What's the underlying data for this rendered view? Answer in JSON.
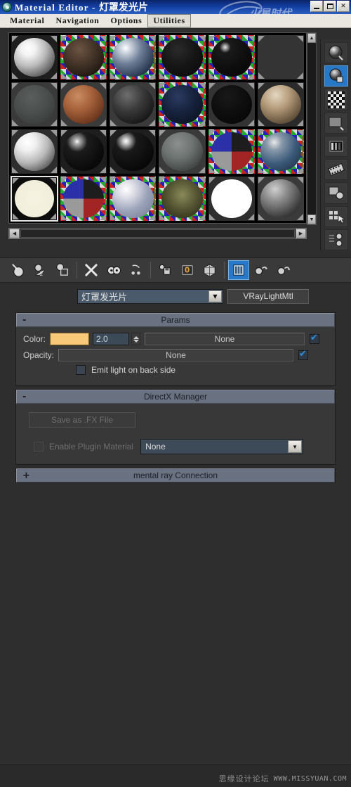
{
  "window": {
    "title_en": "Material Editor",
    "title_sep": " - ",
    "title_cn": "灯罩发光片",
    "icon": "material-editor-icon",
    "buttons": {
      "minimize": "minimize-button",
      "maximize": "maximize-button",
      "close": "✕"
    }
  },
  "menubar": {
    "items": [
      {
        "label": "Material",
        "active": false
      },
      {
        "label": "Navigation",
        "active": false
      },
      {
        "label": "Options",
        "active": false
      },
      {
        "label": "Utilities",
        "active": true
      }
    ]
  },
  "slots": {
    "rows": 4,
    "cols": 6,
    "selected_index": 18,
    "items": [
      {
        "name": "slot-1",
        "style": "shiny-white",
        "checker": false,
        "sphere": "radial-gradient(circle at 35% 28%, #ffffff 0%, #f2f2f2 18%, #bcbcbc 45%, #5a5a5a 78%, #2a2a2a 100%)",
        "bg": "#1e1e1e"
      },
      {
        "name": "slot-2",
        "style": "dark-wood",
        "checker": true,
        "sphere": "radial-gradient(circle at 40% 30%, #6d5442 0%, #4a392c 35%, #241a13 75%, #120d09 100%)",
        "bg": "#1a1a1a"
      },
      {
        "name": "slot-3",
        "style": "glass-checker",
        "checker": true,
        "sphere": "radial-gradient(circle at 32% 26%, #ffffff 0%, #cfd6e0 12%, #6c7d95 40%, #22304a 80%, #0d1421 100%)",
        "bg": "#141414"
      },
      {
        "name": "slot-4",
        "style": "black-rough",
        "checker": true,
        "sphere": "radial-gradient(circle at 40% 30%, #2a2a2a 0%, #161616 45%, #080808 100%)",
        "bg": "#111111"
      },
      {
        "name": "slot-5",
        "style": "black-gloss",
        "checker": true,
        "sphere": "radial-gradient(circle at 34% 24%, #e8e8e8 0%, #1a1a1a 14%, #0c0c0c 60%, #050505 100%)",
        "bg": "#111111"
      },
      {
        "name": "slot-6",
        "style": "empty-gray",
        "checker": false,
        "sphere": "none",
        "bg": "#343434"
      },
      {
        "name": "slot-7",
        "style": "gray-flat",
        "checker": false,
        "sphere": "radial-gradient(circle at 42% 32%, #5a5e5c 0%, #4a4e4c 45%, #303432 100%)",
        "bg": "#3a3a3a"
      },
      {
        "name": "slot-8",
        "style": "copper",
        "checker": false,
        "sphere": "radial-gradient(circle at 36% 28%, #c98d63 0%, #a9643c 35%, #6d381f 75%, #3a1c0f 100%)",
        "bg": "#3a3a3a"
      },
      {
        "name": "slot-9",
        "style": "dark-gloss",
        "checker": false,
        "sphere": "radial-gradient(circle at 36% 26%, #6e6e6e 0%, #3a3a3a 40%, #151515 80%, #0a0a0a 100%)",
        "bg": "#3a3a3a"
      },
      {
        "name": "slot-10",
        "style": "blue-dark",
        "checker": true,
        "sphere": "radial-gradient(circle at 40% 30%, #2b3a60 0%, #16223c 45%, #080c18 100%)",
        "bg": "#1a1a1a"
      },
      {
        "name": "slot-11",
        "style": "near-black",
        "checker": false,
        "sphere": "radial-gradient(circle at 40% 30%, #191919 0%, #0d0d0d 50%, #040404 100%)",
        "bg": "#333333"
      },
      {
        "name": "slot-12",
        "style": "marble-tex",
        "checker": false,
        "sphere": "radial-gradient(circle at 38% 26%, #e2d7c2 0%, #b79d7c 35%, #6d5a43 70%, #2e2519 100%)",
        "bg": "#2a2a2a"
      },
      {
        "name": "slot-13",
        "style": "white-shiny",
        "checker": false,
        "sphere": "radial-gradient(circle at 33% 26%, #ffffff 0%, #efefef 22%, #b8b8b8 52%, #4e4e4e 85%, #222222 100%)",
        "bg": "#2e2e2e"
      },
      {
        "name": "slot-14",
        "style": "black-hl",
        "checker": false,
        "sphere": "radial-gradient(circle at 34% 24%, #ffffff 0%, #b4b4b4 6%, #1c1c1c 26%, #0a0a0a 70%, #050505 100%)",
        "bg": "#1e1e1e"
      },
      {
        "name": "slot-15",
        "style": "black-hl2",
        "checker": false,
        "sphere": "radial-gradient(circle at 33% 23%, #ffffff 0%, #c8c8c8 7%, #1a1a1a 25%, #090909 72%, #040404 100%)",
        "bg": "#1e1e1e"
      },
      {
        "name": "slot-16",
        "style": "gray-satin",
        "checker": false,
        "sphere": "radial-gradient(circle at 40% 30%, #8b8f8d 0%, #6d7371 40%, #3d4240 80%, #202523 100%)",
        "bg": "#3a3a3a"
      },
      {
        "name": "slot-17",
        "style": "multi-quad",
        "checker": true,
        "sphere": "conic-gradient(from 180deg, #9a9a9a 0deg 90deg, #2b2fa8 90deg 180deg, #1d1d1d 180deg 270deg, #a32424 270deg 360deg)",
        "bg": "#141414"
      },
      {
        "name": "slot-18",
        "style": "noisy-checker",
        "checker": true,
        "sphere": "radial-gradient(circle at 34% 26%, #e8e8e8 0%, #8899aa 20%, #3b5a7a 55%, #18263a 100%)",
        "bg": "#141414"
      },
      {
        "name": "slot-19",
        "style": "cream-emissive",
        "checker": false,
        "sphere": "radial-gradient(circle at 50% 50%, #f6f3e2 0%, #f2eedb 70%, #e9e4cd 100%)",
        "bg": "#0d0d0d"
      },
      {
        "name": "slot-20",
        "style": "multi-quad2",
        "checker": true,
        "sphere": "conic-gradient(from 180deg, #9a9a9a 0deg 90deg, #2b2fa8 90deg 180deg, #1d1d1d 180deg 270deg, #a32424 270deg 360deg)",
        "bg": "#141414"
      },
      {
        "name": "slot-21",
        "style": "frost-checker",
        "checker": true,
        "sphere": "radial-gradient(circle at 33% 26%, #ffffff 0%, #dcdce6 22%, #9aa2b8 55%, #6f7892 100%)",
        "bg": "#141414"
      },
      {
        "name": "slot-22",
        "style": "olive-cloth",
        "checker": true,
        "sphere": "radial-gradient(circle at 50% 40%, #8a8a5a 0%, #5c5c38 40%, #30301c 85%, #16160c 100%)",
        "bg": "#141414"
      },
      {
        "name": "slot-23",
        "style": "pure-white",
        "checker": false,
        "sphere": "radial-gradient(circle at 50% 50%, #ffffff 0%, #ffffff 76%, #f2f2f2 100%)",
        "bg": "#2e2e2e"
      },
      {
        "name": "slot-24",
        "style": "gray-shaded",
        "checker": false,
        "sphere": "radial-gradient(circle at 36% 26%, #cfcfcf 0%, #8e8e8e 30%, #3c3c3c 72%, #1c1c1c 100%)",
        "bg": "#3a3a3a"
      }
    ],
    "vscroll": {
      "up": "▲",
      "down": "▼"
    },
    "hscroll": {
      "left": "◀",
      "right": "▶"
    }
  },
  "right_strip": {
    "items": [
      {
        "name": "sample-type-sphere-icon",
        "active": false
      },
      {
        "name": "backlight-icon",
        "active": true
      },
      {
        "name": "background-checker-icon",
        "active": false
      },
      {
        "name": "sample-uv-tiling-icon",
        "active": false
      },
      {
        "name": "video-color-check-icon",
        "active": false
      },
      {
        "name": "make-preview-icon",
        "active": false
      },
      {
        "name": "options-icon",
        "active": false
      },
      {
        "name": "select-by-material-icon",
        "active": false
      },
      {
        "name": "material-map-navigator-icon",
        "active": false
      }
    ]
  },
  "toolbar": {
    "items": [
      {
        "name": "get-material-icon",
        "active": false,
        "sep": false
      },
      {
        "name": "put-material-to-scene-icon",
        "active": false,
        "sep": false
      },
      {
        "name": "assign-material-to-selection-icon",
        "active": false,
        "sep": true
      },
      {
        "name": "reset-map-material-icon",
        "active": false,
        "sep": false
      },
      {
        "name": "make-material-copy-icon",
        "active": false,
        "sep": false
      },
      {
        "name": "make-unique-icon",
        "active": false,
        "sep": true
      },
      {
        "name": "put-to-library-icon",
        "active": false,
        "sep": false
      },
      {
        "name": "material-effects-channel-icon",
        "active": false,
        "sep": false
      },
      {
        "name": "show-map-in-viewport-icon",
        "active": false,
        "sep": true
      },
      {
        "name": "show-end-result-icon",
        "active": true,
        "sep": false
      },
      {
        "name": "go-to-parent-icon",
        "active": false,
        "sep": false
      },
      {
        "name": "go-forward-to-sibling-icon",
        "active": false,
        "sep": false
      }
    ]
  },
  "material": {
    "picker_icon": "eyedropper-icon",
    "name_value": "灯罩发光片",
    "name_dropdown_glyph": "▼",
    "type_label": "VRayLightMtl"
  },
  "rollouts": [
    {
      "name": "params",
      "title": "Params",
      "toggle": "-",
      "expanded": true
    },
    {
      "name": "directx-manager",
      "title": "DirectX Manager",
      "toggle": "-",
      "expanded": true
    },
    {
      "name": "mental-ray-connection",
      "title": "mental ray Connection",
      "toggle": "+",
      "expanded": false
    }
  ],
  "params": {
    "color_label": "Color:",
    "color_hex": "#f8c979",
    "multiplier_value": "2.0",
    "color_map_label": "None",
    "color_map_enabled": true,
    "opacity_label": "Opacity:",
    "opacity_map_label": "None",
    "opacity_map_enabled": true,
    "emit_back_label": "Emit light on back side",
    "emit_back_checked": false
  },
  "directx": {
    "save_fx_label": "Save as .FX File",
    "save_fx_disabled": true,
    "enable_plugin_label": "Enable Plugin Material",
    "enable_plugin_checked": false,
    "enable_plugin_disabled": true,
    "plugin_value": "None",
    "plugin_dropdown_glyph": "▼"
  },
  "watermark": {
    "cn": "思缘设计论坛",
    "url": "WWW.MISSYUAN.COM"
  }
}
